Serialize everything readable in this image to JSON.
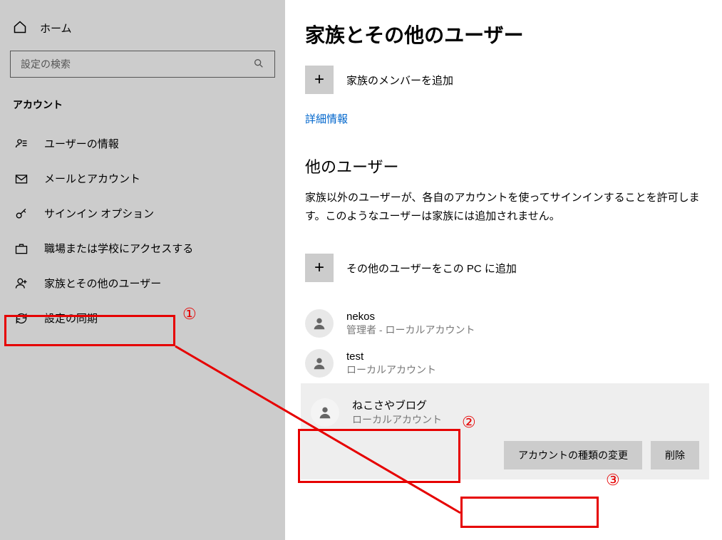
{
  "sidebar": {
    "home_label": "ホーム",
    "search_placeholder": "設定の検索",
    "section_label": "アカウント",
    "items": [
      {
        "label": "ユーザーの情報"
      },
      {
        "label": "メールとアカウント"
      },
      {
        "label": "サインイン オプション"
      },
      {
        "label": "職場または学校にアクセスする"
      },
      {
        "label": "家族とその他のユーザー"
      },
      {
        "label": "設定の同期"
      }
    ]
  },
  "main": {
    "title": "家族とその他のユーザー",
    "add_family_label": "家族のメンバーを追加",
    "more_info_link": "詳細情報",
    "other_users_heading": "他のユーザー",
    "other_users_desc": "家族以外のユーザーが、各自のアカウントを使ってサインインすることを許可します。このようなユーザーは家族には追加されません。",
    "add_other_label": "その他のユーザーをこの PC に追加",
    "users": [
      {
        "name": "nekos",
        "role": "管理者 - ローカルアカウント"
      },
      {
        "name": "test",
        "role": "ローカルアカウント"
      },
      {
        "name": "ねこさやブログ",
        "role": "ローカルアカウント"
      }
    ],
    "change_type_btn": "アカウントの種類の変更",
    "delete_btn": "削除"
  },
  "annotations": {
    "marker1": "①",
    "marker2": "②",
    "marker3": "③"
  }
}
